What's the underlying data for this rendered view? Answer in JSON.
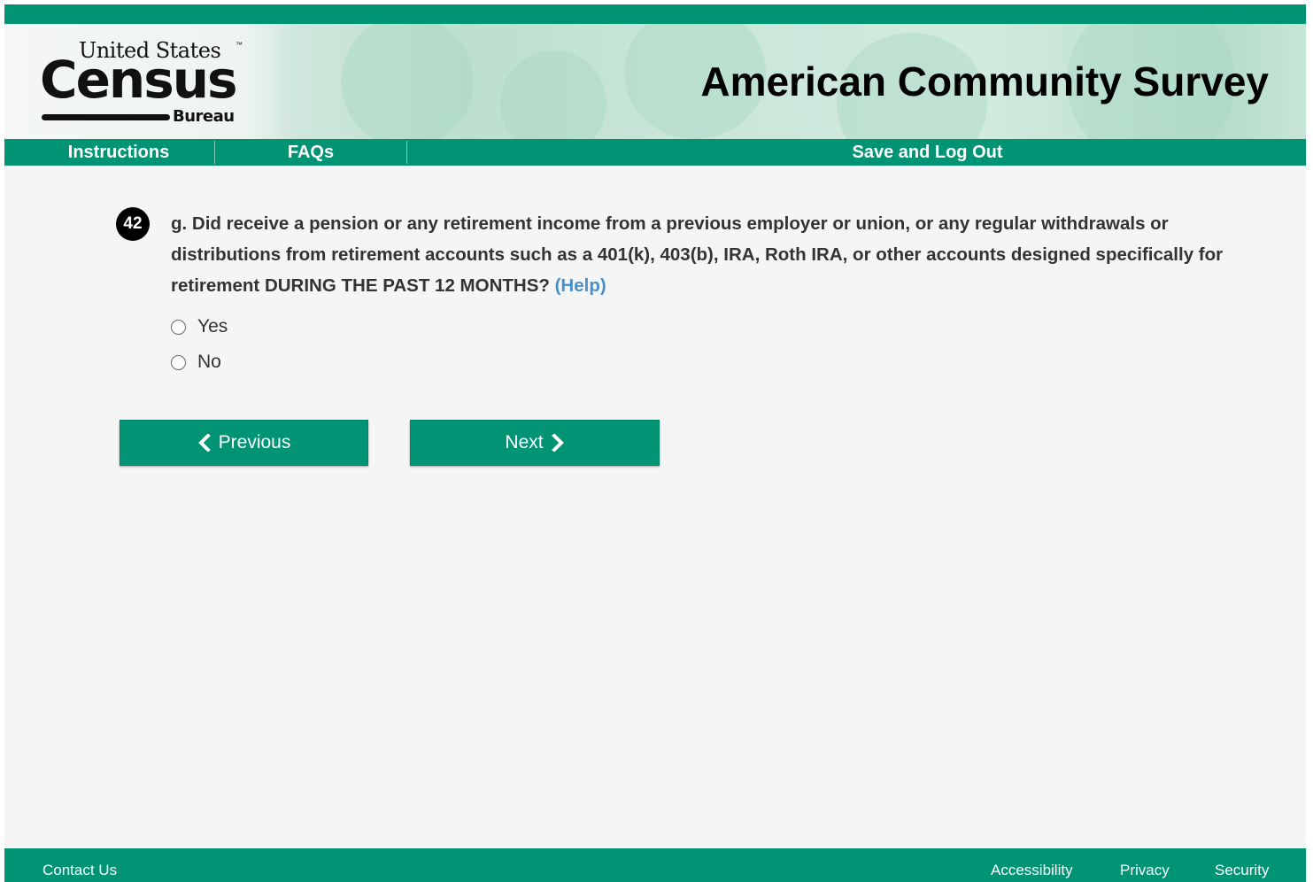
{
  "header": {
    "logo": {
      "top": "United States",
      "tm": "™",
      "main": "Census",
      "bottom": "Bureau"
    },
    "title": "American Community Survey"
  },
  "nav": {
    "instructions": "Instructions",
    "faqs": "FAQs",
    "save_logout": "Save and Log Out"
  },
  "question": {
    "number": "42",
    "text": "g. Did receive a pension or any retirement income from a previous employer or union, or any regular withdrawals or distributions from retirement accounts such as a 401(k), 403(b), IRA, Roth IRA, or other accounts designed specifically for retirement DURING THE PAST 12 MONTHS?",
    "help": "(Help)",
    "options": [
      {
        "label": "Yes",
        "selected": false
      },
      {
        "label": "No",
        "selected": false
      }
    ]
  },
  "buttons": {
    "previous": "Previous",
    "next": "Next"
  },
  "footer": {
    "contact": "Contact Us",
    "accessibility": "Accessibility",
    "privacy": "Privacy",
    "security": "Security"
  },
  "colors": {
    "brand_green": "#009474",
    "help_link": "#4a90c8"
  }
}
